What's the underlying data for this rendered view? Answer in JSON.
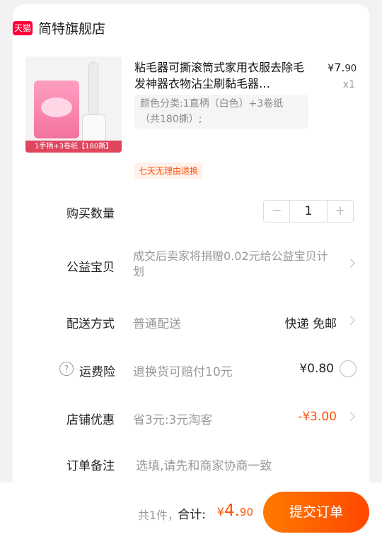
{
  "shop": {
    "logo_text": "天猫",
    "name": "简特旗舰店"
  },
  "product": {
    "title": "粘毛器可撕滚筒式家用衣服去除毛发神器衣物沾尘刷黏毛器…",
    "price_currency": "¥",
    "price_int": "7.",
    "price_dec": "90",
    "quantity_text": "x1",
    "sku": "颜色分类:1直柄（白色）+3卷纸（共180撕）;",
    "thumb_badge": "1手柄+3卷纸【180撕】",
    "promise": "七天无理由退换"
  },
  "rows": {
    "quantity_label": "购买数量",
    "quantity_minus": "−",
    "quantity_value": "1",
    "quantity_plus": "+",
    "welfare_label": "公益宝贝",
    "welfare_text": "成交后卖家将捐赠0.02元给公益宝贝计划",
    "delivery_label": "配送方式",
    "delivery_value": "普通配送",
    "delivery_right": "快递 免邮",
    "insurance_label": "运费险",
    "insurance_help_icon": "?",
    "insurance_desc": "退换货可赔付10元",
    "insurance_price": "¥0.80",
    "discount_label": "店铺优惠",
    "discount_desc": "省3元:3元淘客",
    "discount_value": "-¥3.00",
    "note_label": "订单备注",
    "note_placeholder": "选填,请先和商家协商一致"
  },
  "footer": {
    "count": "共1件，",
    "total_label": "合计:",
    "total_currency": "¥",
    "total_int": "4.",
    "total_dec": "90",
    "submit_label": "提交订单"
  },
  "colors": {
    "accent": "#ff5000",
    "tmall_red": "#ff0036"
  }
}
